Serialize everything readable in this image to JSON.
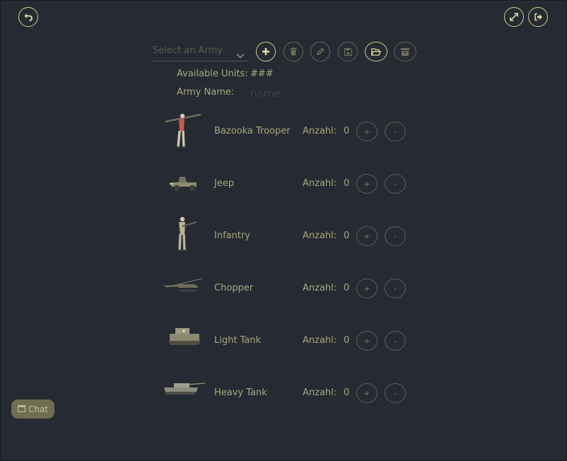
{
  "header": {
    "back_icon": "undo-arrow-icon",
    "fullscreen_icon": "expand-icon",
    "logout_icon": "sign-out-icon"
  },
  "toolbar": {
    "army_select": {
      "placeholder": "Select an Army"
    },
    "buttons": [
      {
        "icon": "plus-icon",
        "active": true
      },
      {
        "icon": "trash-icon",
        "active": false
      },
      {
        "icon": "pencil-icon",
        "active": false
      },
      {
        "icon": "save-icon",
        "active": false
      },
      {
        "icon": "folder-open-icon",
        "active": true
      },
      {
        "icon": "archive-icon",
        "active": false
      }
    ]
  },
  "info": {
    "available_label": "Available Units:",
    "available_value": "###",
    "army_name_label": "Army Name:",
    "army_name_placeholder": "name"
  },
  "units": [
    {
      "name": "Bazooka Trooper",
      "count_label": "Anzahl:",
      "count": "0",
      "plus": "+",
      "minus": "-"
    },
    {
      "name": "Jeep",
      "count_label": "Anzahl:",
      "count": "0",
      "plus": "+",
      "minus": "-"
    },
    {
      "name": "Infantry",
      "count_label": "Anzahl:",
      "count": "0",
      "plus": "+",
      "minus": "-"
    },
    {
      "name": "Chopper",
      "count_label": "Anzahl:",
      "count": "0",
      "plus": "+",
      "minus": "-"
    },
    {
      "name": "Light Tank",
      "count_label": "Anzahl:",
      "count": "0",
      "plus": "+",
      "minus": "-"
    },
    {
      "name": "Heavy Tank",
      "count_label": "Anzahl:",
      "count": "0",
      "plus": "+",
      "minus": "-"
    }
  ],
  "chat": {
    "label": "Chat",
    "icon": "window-icon"
  },
  "colors": {
    "background": "#262a33",
    "accent": "#d2d08a",
    "text": "#a8a87c",
    "chat_bg": "#6f6e52"
  }
}
